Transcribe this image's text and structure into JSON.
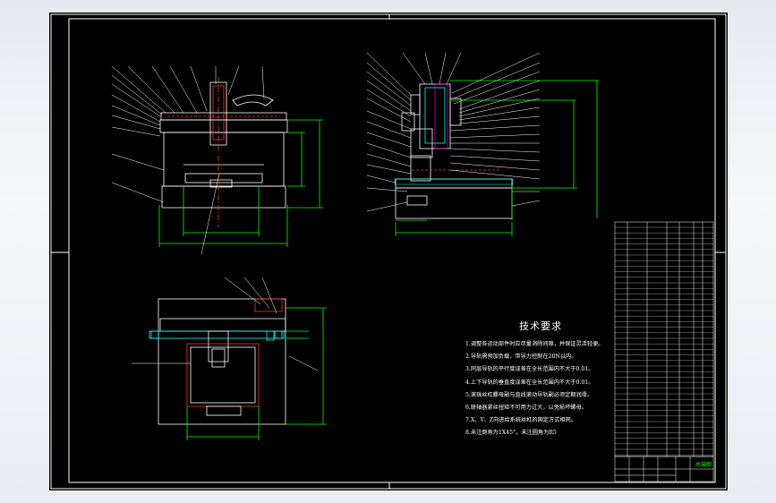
{
  "drawing": {
    "notes_title": "技术要求",
    "notes": [
      "1.调整各运动部件时应尽量消除间隙，并保证灵活轻便。",
      "2.导轨需预加负载，带导力控制在20N以内。",
      "3.同层导轨的平行度误差在全长范围内不大于0.01。",
      "4.上下导轨的垂直度误差在全长范围内不大于0.01。",
      "5.滚珠丝杠螺母副与直线滚动导轨副必须定期润滑。",
      "6.联轴器紧丝扭矩不可用力过大，以免损坏螺母。",
      "7.X、Y、Z向进给系统丝杠的固定方式相同。",
      "8.未注倒角为1X45°，未注圆角为R5"
    ],
    "title_block": {
      "drawing_label": "总装图"
    }
  },
  "colors": {
    "background": "#000000",
    "line": "#ffffff",
    "dimension": "#00ff00",
    "hidden": "#ff3030",
    "accent": "#00ffff",
    "mark": "#ff00ff"
  }
}
